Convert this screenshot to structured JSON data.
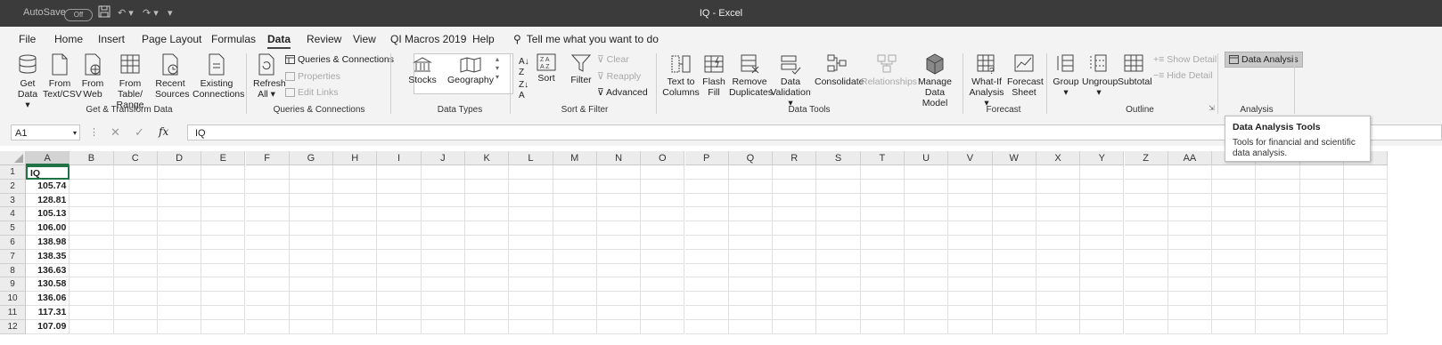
{
  "titlebar": {
    "autosave_label": "AutoSave",
    "autosave_state": "Off",
    "window_title": "IQ  -  Excel"
  },
  "menu": {
    "tabs": [
      "File",
      "Home",
      "Insert",
      "Page Layout",
      "Formulas",
      "Data",
      "Review",
      "View",
      "QI Macros 2019",
      "Help"
    ],
    "active_tab": "Data",
    "tell_me": "Tell me what you want to do"
  },
  "ribbon": {
    "get_transform": {
      "get_data": [
        "Get",
        "Data"
      ],
      "from_text_csv": [
        "From",
        "Text/CSV"
      ],
      "from_web": [
        "From",
        "Web"
      ],
      "from_table": [
        "From Table/",
        "Range"
      ],
      "recent_sources": [
        "Recent",
        "Sources"
      ],
      "existing_connections": [
        "Existing",
        "Connections"
      ],
      "label": "Get & Transform Data"
    },
    "queries": {
      "refresh_all": [
        "Refresh",
        "All"
      ],
      "queries_connections": "Queries & Connections",
      "properties": "Properties",
      "edit_links": "Edit Links",
      "label": "Queries & Connections"
    },
    "data_types": {
      "stocks": "Stocks",
      "geography": "Geography",
      "label": "Data Types"
    },
    "sort_filter": {
      "sort": "Sort",
      "filter": "Filter",
      "clear": "Clear",
      "reapply": "Reapply",
      "advanced": "Advanced",
      "label": "Sort & Filter"
    },
    "data_tools": {
      "text_to_columns": [
        "Text to",
        "Columns"
      ],
      "flash_fill": [
        "Flash",
        "Fill"
      ],
      "remove_duplicates": [
        "Remove",
        "Duplicates"
      ],
      "data_validation": [
        "Data",
        "Validation"
      ],
      "consolidate": "Consolidate",
      "relationships": "Relationships",
      "manage_data_model": [
        "Manage",
        "Data Model"
      ],
      "label": "Data Tools"
    },
    "forecast": {
      "what_if": [
        "What-If",
        "Analysis"
      ],
      "forecast_sheet": [
        "Forecast",
        "Sheet"
      ],
      "label": "Forecast"
    },
    "outline": {
      "group": "Group",
      "ungroup": "Ungroup",
      "subtotal": "Subtotal",
      "show_detail": "Show Detail",
      "hide_detail": "Hide Detail",
      "label": "Outline"
    },
    "analysis": {
      "data_analysis": "Data Analysis",
      "label": "Analysis"
    }
  },
  "formula_bar": {
    "name_box": "A1",
    "fx_symbol": "fx",
    "content": "IQ"
  },
  "sheet": {
    "columns": [
      "A",
      "B",
      "C",
      "D",
      "E",
      "F",
      "G",
      "H",
      "I",
      "J",
      "K",
      "L",
      "M",
      "N",
      "O",
      "P",
      "Q",
      "R",
      "S",
      "T",
      "U",
      "V",
      "W",
      "X",
      "Y",
      "Z",
      "AA"
    ],
    "rows": [
      "1",
      "2",
      "3",
      "4",
      "5",
      "6",
      "7",
      "8",
      "9",
      "10",
      "11",
      "12"
    ],
    "col_a_values": [
      "IQ",
      "105.74",
      "128.81",
      "105.13",
      "106.00",
      "138.98",
      "138.35",
      "136.63",
      "130.58",
      "136.06",
      "117.31",
      "107.09"
    ],
    "selected_cell": "A1"
  },
  "tooltip": {
    "title": "Data Analysis Tools",
    "body": "Tools for financial and scientific data analysis."
  }
}
